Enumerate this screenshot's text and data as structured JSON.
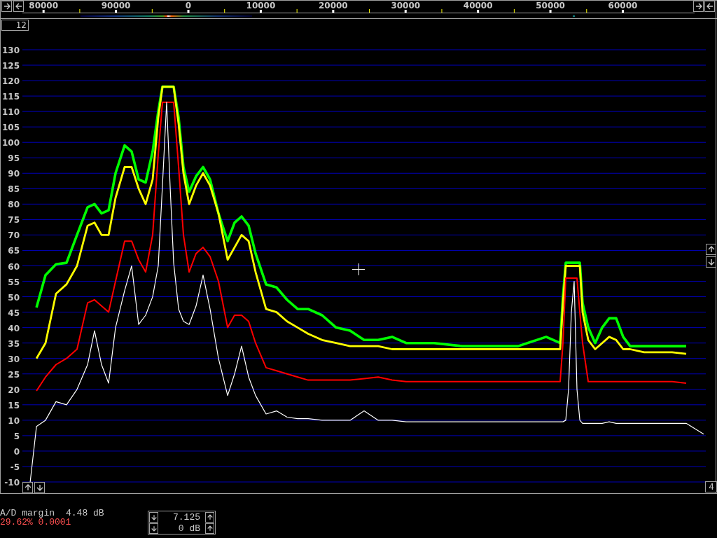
{
  "channel_box": {
    "value": "12"
  },
  "frequency_scale": {
    "wrapped_labels": [
      "80000",
      "90000"
    ]
  },
  "spectrum": {
    "chart_data": {
      "type": "line",
      "grid": true,
      "x": [
        -21850,
        -20980,
        -19730,
        -18280,
        -16830,
        -15380,
        -13920,
        -12960,
        -11990,
        -11020,
        -10060,
        -8800,
        -7830,
        -6870,
        -5900,
        -4930,
        -4160,
        -3580,
        -3000,
        -2510,
        -2030,
        -1350,
        -680,
        100,
        1060,
        2030,
        3000,
        4160,
        5420,
        6380,
        7350,
        8320,
        9280,
        10730,
        12180,
        13630,
        15090,
        16540,
        18470,
        20400,
        22340,
        24270,
        26210,
        28140,
        30070,
        33940,
        37810,
        41680,
        45550,
        49410,
        51350,
        51730,
        52120,
        52510,
        52890,
        53280,
        53670,
        54060,
        54440,
        55220,
        56180,
        57150,
        58120,
        59080,
        60050,
        61020,
        62950,
        64890,
        66820,
        68750,
        71170
      ],
      "series": [
        {
          "color": "#00ff00",
          "values": [
            null,
            46.5,
            57,
            60.5,
            61,
            70,
            79,
            80,
            77,
            78,
            90,
            99,
            97,
            88,
            87,
            97,
            110,
            118,
            118,
            118,
            118,
            108,
            92,
            84,
            89,
            92,
            88,
            77,
            68,
            74,
            76,
            73,
            64,
            54,
            53,
            49,
            46,
            46,
            44,
            40,
            39,
            36,
            36,
            37,
            35,
            35,
            34,
            34,
            34,
            37,
            35,
            50,
            61,
            61,
            61,
            61,
            61,
            61,
            48,
            40,
            35,
            40,
            43,
            43,
            37,
            34,
            34,
            34,
            34,
            34,
            null
          ]
        },
        {
          "color": "#ffff00",
          "values": [
            null,
            30,
            35,
            51,
            54,
            60,
            73,
            74,
            70,
            70,
            82,
            92,
            92,
            85,
            80,
            88,
            108,
            118,
            118,
            118,
            118,
            106,
            90,
            80,
            86,
            90,
            86,
            77,
            62,
            66,
            70,
            68,
            58,
            46,
            45,
            42,
            40,
            38,
            36,
            35,
            34,
            34,
            34,
            33,
            33,
            33,
            33,
            33,
            33,
            33,
            33,
            48,
            60,
            60,
            60,
            60,
            60,
            60,
            45,
            36,
            33,
            35,
            37,
            36,
            33,
            33,
            32,
            32,
            32,
            31.5,
            null
          ]
        },
        {
          "color": "#ff0000",
          "values": [
            null,
            19.5,
            24,
            28,
            30,
            33,
            48,
            49,
            47,
            45,
            55,
            68,
            68,
            62,
            58,
            70,
            96,
            113,
            113,
            113,
            113,
            92,
            70,
            58,
            64,
            66,
            63,
            55,
            40,
            44,
            44,
            42,
            35,
            27,
            26,
            25,
            24,
            23,
            23,
            23,
            23,
            23.5,
            24,
            23,
            22.5,
            22.5,
            22.5,
            22.5,
            22.5,
            22.5,
            22.5,
            35,
            56,
            56,
            56,
            56,
            56,
            45,
            35,
            22.5,
            22.5,
            22.5,
            22.5,
            22.5,
            22.5,
            22.5,
            22.5,
            22.5,
            22.5,
            22,
            null
          ]
        },
        {
          "color": "#ffffff",
          "values": [
            -10,
            8,
            10,
            16,
            15,
            20,
            28,
            39,
            28,
            22,
            40,
            52,
            60,
            41,
            44,
            50,
            60,
            86,
            113,
            85,
            61,
            46,
            42,
            41,
            47,
            57,
            46,
            30,
            18,
            25,
            34,
            24,
            18,
            12,
            13,
            11,
            10.5,
            10.5,
            10,
            10,
            10,
            13,
            10,
            10,
            9.5,
            9.5,
            9.5,
            9.5,
            9.5,
            9.5,
            9.5,
            9.5,
            10,
            20,
            45,
            55,
            20,
            10,
            9,
            9,
            9,
            9,
            9.5,
            9,
            9,
            9,
            9,
            9,
            9,
            9,
            5.5
          ]
        }
      ],
      "xlim": [
        -22920,
        71460
      ],
      "ylim": [
        -10,
        130
      ],
      "xticks": [
        0,
        10000,
        20000,
        30000,
        40000,
        50000,
        60000
      ],
      "yticks": [
        130,
        125,
        120,
        115,
        110,
        105,
        100,
        95,
        90,
        85,
        80,
        75,
        70,
        65,
        60,
        55,
        50,
        45,
        40,
        35,
        30,
        25,
        20,
        15,
        10,
        5,
        0,
        -5,
        -10
      ]
    }
  },
  "corner_box": {
    "value": "4"
  },
  "status": {
    "margin_label": "A/D margin",
    "margin_value": "4.48 dB",
    "readout": "29.62% 0.0001"
  },
  "adjusters": [
    {
      "value": "7.125"
    },
    {
      "value": "0 dB"
    }
  ]
}
